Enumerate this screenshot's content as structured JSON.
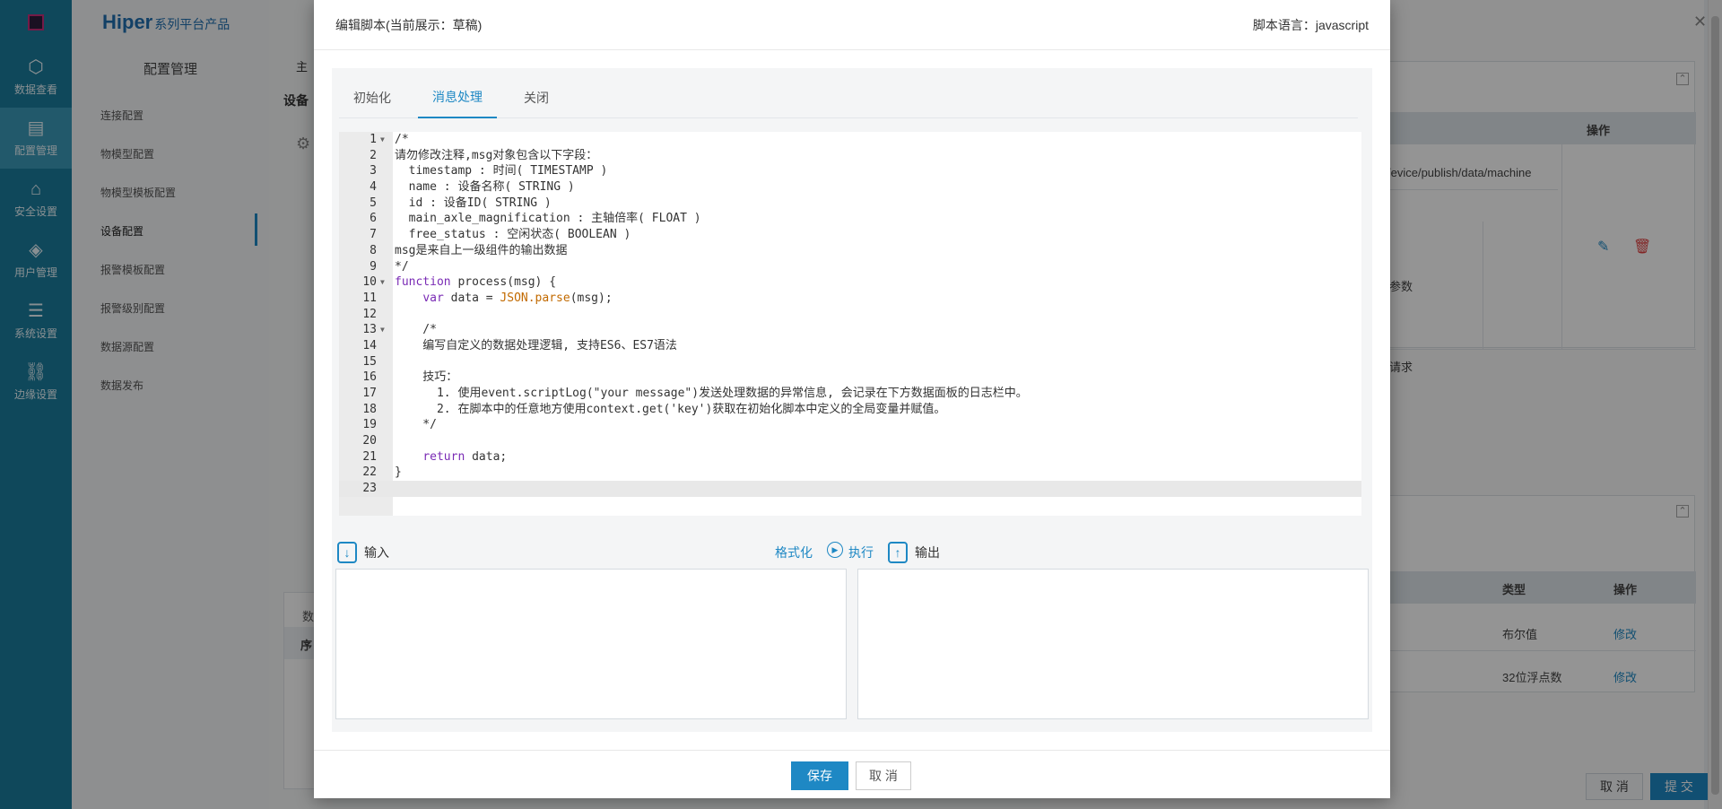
{
  "brand": {
    "name": "Hiper",
    "suffix": "系列平台产品"
  },
  "rail": [
    {
      "label": "数据查看",
      "icon": "⬡"
    },
    {
      "label": "配置管理",
      "icon": "▤"
    },
    {
      "label": "安全设置",
      "icon": "⌂"
    },
    {
      "label": "用户管理",
      "icon": "◈"
    },
    {
      "label": "系统设置",
      "icon": "☰"
    },
    {
      "label": "边缘设置",
      "icon": "⛓"
    }
  ],
  "menu": {
    "title": "配置管理",
    "items": [
      "连接配置",
      "物模型配置",
      "物模型模板配置",
      "设备配置",
      "报警模板配置",
      "报警级别配置",
      "数据源配置",
      "数据发布"
    ]
  },
  "background": {
    "crumb": "主",
    "heading": "设备",
    "side_table": {
      "op_header": "操作",
      "topic": "/evice/publish/data/machine",
      "param": "参数",
      "request": "请求"
    },
    "types_table": {
      "type_header": "类型",
      "op_header": "操作",
      "rows": [
        {
          "type": "布尔值",
          "op": "修改"
        },
        {
          "type": "32位浮点数",
          "op": "修改"
        }
      ],
      "left_headers": [
        "数",
        "序"
      ]
    },
    "buttons": {
      "cancel": "取 消",
      "submit": "提 交"
    }
  },
  "modal": {
    "title": "编辑脚本(当前展示：草稿)",
    "language_label": "脚本语言：",
    "language": "javascript",
    "tabs": [
      "初始化",
      "消息处理",
      "关闭"
    ],
    "active_tab": 1,
    "code_lines": [
      "/*",
      "请勿修改注释,msg对象包含以下字段：",
      "  timestamp : 时间( TIMESTAMP )",
      "  name : 设备名称( STRING )",
      "  id : 设备ID( STRING )",
      "  main_axle_magnification : 主轴倍率( FLOAT )",
      "  free_status : 空闲状态( BOOLEAN )",
      "msg是来自上一级组件的输出数据",
      "*/",
      "function process(msg) {",
      "    var data = JSON.parse(msg);",
      "",
      "    /*",
      "    编写自定义的数据处理逻辑, 支持ES6、ES7语法",
      "",
      "    技巧：",
      "      1. 使用event.scriptLog(\"your message\")发送处理数据的异常信息, 会记录在下方数据面板的日志栏中。",
      "      2. 在脚本中的任意地方使用context.get('key')获取在初始化脚本中定义的全局变量并赋值。",
      "    */",
      "",
      "    return data;",
      "}",
      ""
    ],
    "input_label": "输入",
    "output_label": "输出",
    "format_label": "格式化",
    "run_label": "执行",
    "input_value": "",
    "output_value": "",
    "save_label": "保存",
    "cancel_label": "取 消"
  }
}
